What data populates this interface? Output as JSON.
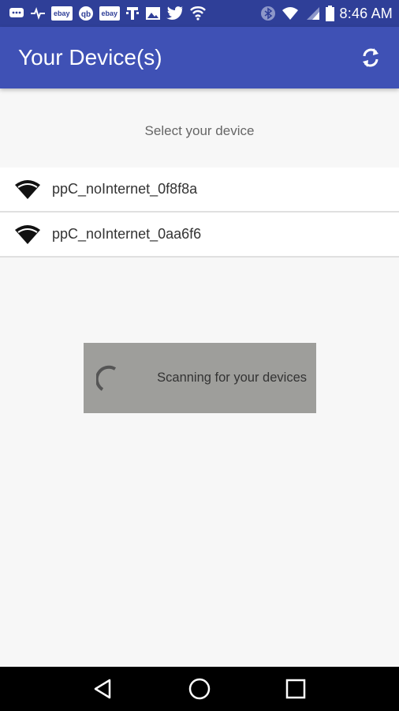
{
  "status_bar": {
    "left_icons": [
      "message-icon",
      "pulse-icon",
      "ebay-icon",
      "qb-icon",
      "ebay-icon",
      "t-mobile-icon",
      "image-icon",
      "twitter-icon",
      "shield-icon"
    ],
    "pills": {
      "ebay": "ebay",
      "qb": "qb"
    },
    "right_icons": [
      "bluetooth-icon",
      "wifi-icon",
      "signal-icon",
      "battery-icon"
    ],
    "time": "8:46 AM"
  },
  "app_bar": {
    "title": "Your Device(s)",
    "refresh_icon": "refresh-icon"
  },
  "subtitle": "Select your device",
  "devices": [
    {
      "label": "ppC_noInternet_0f8f8a",
      "icon": "wifi-icon"
    },
    {
      "label": "ppC_noInternet_0aa6f6",
      "icon": "wifi-icon"
    }
  ],
  "scan_dialog": {
    "message": "Scanning for your devices"
  },
  "colors": {
    "status_bar": "#2f3f98",
    "app_bar": "#3f51b5",
    "background": "#f7f7f7",
    "dialog": "#9e9e9b"
  },
  "nav_bar": {
    "icons": [
      "back-icon",
      "home-icon",
      "recents-icon"
    ]
  }
}
